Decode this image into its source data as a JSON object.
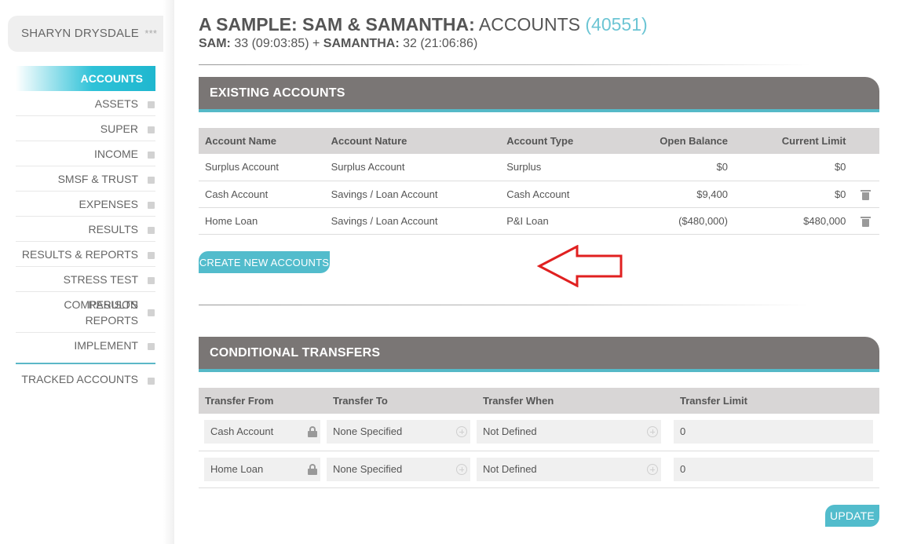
{
  "user": {
    "name": "SHARYN DRYSDALE",
    "stars": "***"
  },
  "nav": {
    "items": [
      {
        "label": "ACCOUNTS"
      },
      {
        "label": "ASSETS"
      },
      {
        "label": "SUPER"
      },
      {
        "label": "INCOME"
      },
      {
        "label": "SMSF & TRUST"
      },
      {
        "label": "EXPENSES"
      },
      {
        "label": "RESULTS"
      },
      {
        "label": "RESULTS & REPORTS"
      },
      {
        "label": "STRESS TEST RESULTS"
      },
      {
        "label_line1": "COMPARISON",
        "label_line2": "REPORTS"
      },
      {
        "label": "IMPLEMENT"
      },
      {
        "label": "TRACKED ACCOUNTS"
      }
    ]
  },
  "header": {
    "title_bold": "A SAMPLE: SAM & SAMANTHA:",
    "title_rest": "ACCOUNTS",
    "title_id": "(40551)",
    "sub_name1": "SAM:",
    "sub_val1": "33 (09:03:85) +",
    "sub_name2": "SAMANTHA:",
    "sub_val2": "32 (21:06:86)"
  },
  "existing": {
    "title": "EXISTING ACCOUNTS",
    "columns": [
      "Account Name",
      "Account Nature",
      "Account Type",
      "Open Balance",
      "Current Limit"
    ],
    "rows": [
      {
        "name": "Surplus Account",
        "nature": "Surplus Account",
        "type": "Surplus",
        "open": "$0",
        "limit": "$0"
      },
      {
        "name": "Cash Account",
        "nature": "Savings / Loan Account",
        "type": "Cash Account",
        "open": "$9,400",
        "limit": "$0"
      },
      {
        "name": "Home Loan",
        "nature": "Savings / Loan Account",
        "type": "P&I Loan",
        "open": "($480,000)",
        "limit": "$480,000"
      }
    ],
    "create_label": "CREATE NEW ACCOUNTS"
  },
  "transfers": {
    "title": "CONDITIONAL TRANSFERS",
    "columns": [
      "Transfer From",
      "Transfer To",
      "Transfer When",
      "Transfer Limit"
    ],
    "rows": [
      {
        "from": "Cash Account",
        "to": "None Specified",
        "when": "Not Defined",
        "limit": "0"
      },
      {
        "from": "Home Loan",
        "to": "None Specified",
        "when": "Not Defined",
        "limit": "0"
      }
    ],
    "update_label": "UPDATE"
  },
  "colors": {
    "accent": "#52bccc",
    "header_bg": "#7a7675",
    "annotation_arrow": "#e02020"
  }
}
